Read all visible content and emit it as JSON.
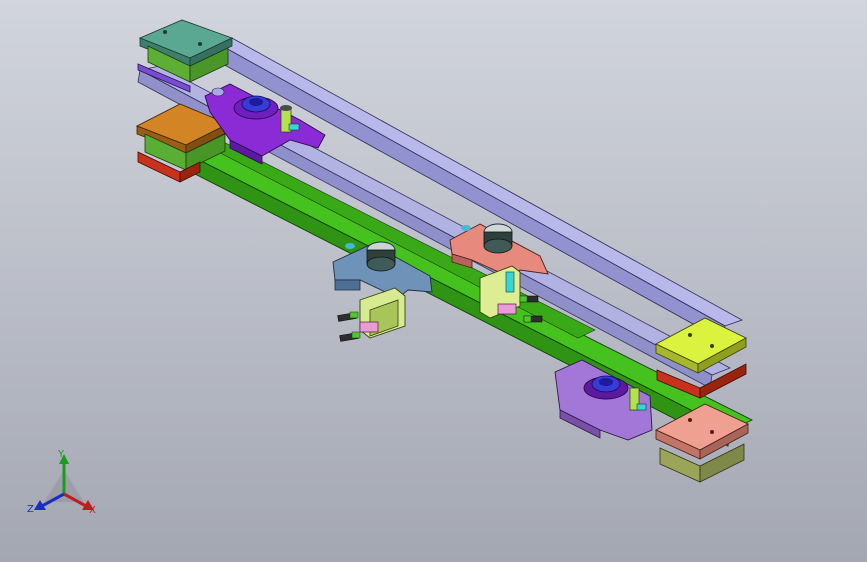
{
  "viewport": {
    "background_top": "#d2d5dd",
    "background_bottom": "#a4a7b2",
    "colors": {
      "lavender_rail": "#a8a8e0",
      "green_rail": "#39b01a",
      "teal_block": "#4f9a86",
      "orange_block": "#c97a1a",
      "red_plate": "#c8321c",
      "yellow_block": "#d8ef3a",
      "salmon_block": "#ef9d8c",
      "purple_bracket": "#8b2bd6",
      "steel_blue_bracket": "#6f93b8",
      "pink_bracket": "#e8897d",
      "lilac_bracket": "#a277d8",
      "pale_green_base": "#a9d36a",
      "olive_base": "#9aa55a"
    }
  },
  "triad": {
    "y_label": "Y",
    "z_label": "Z",
    "x_label": "X",
    "y_color": "#1a9e1a",
    "z_color": "#1d2cc2",
    "x_color": "#c21d1d"
  }
}
